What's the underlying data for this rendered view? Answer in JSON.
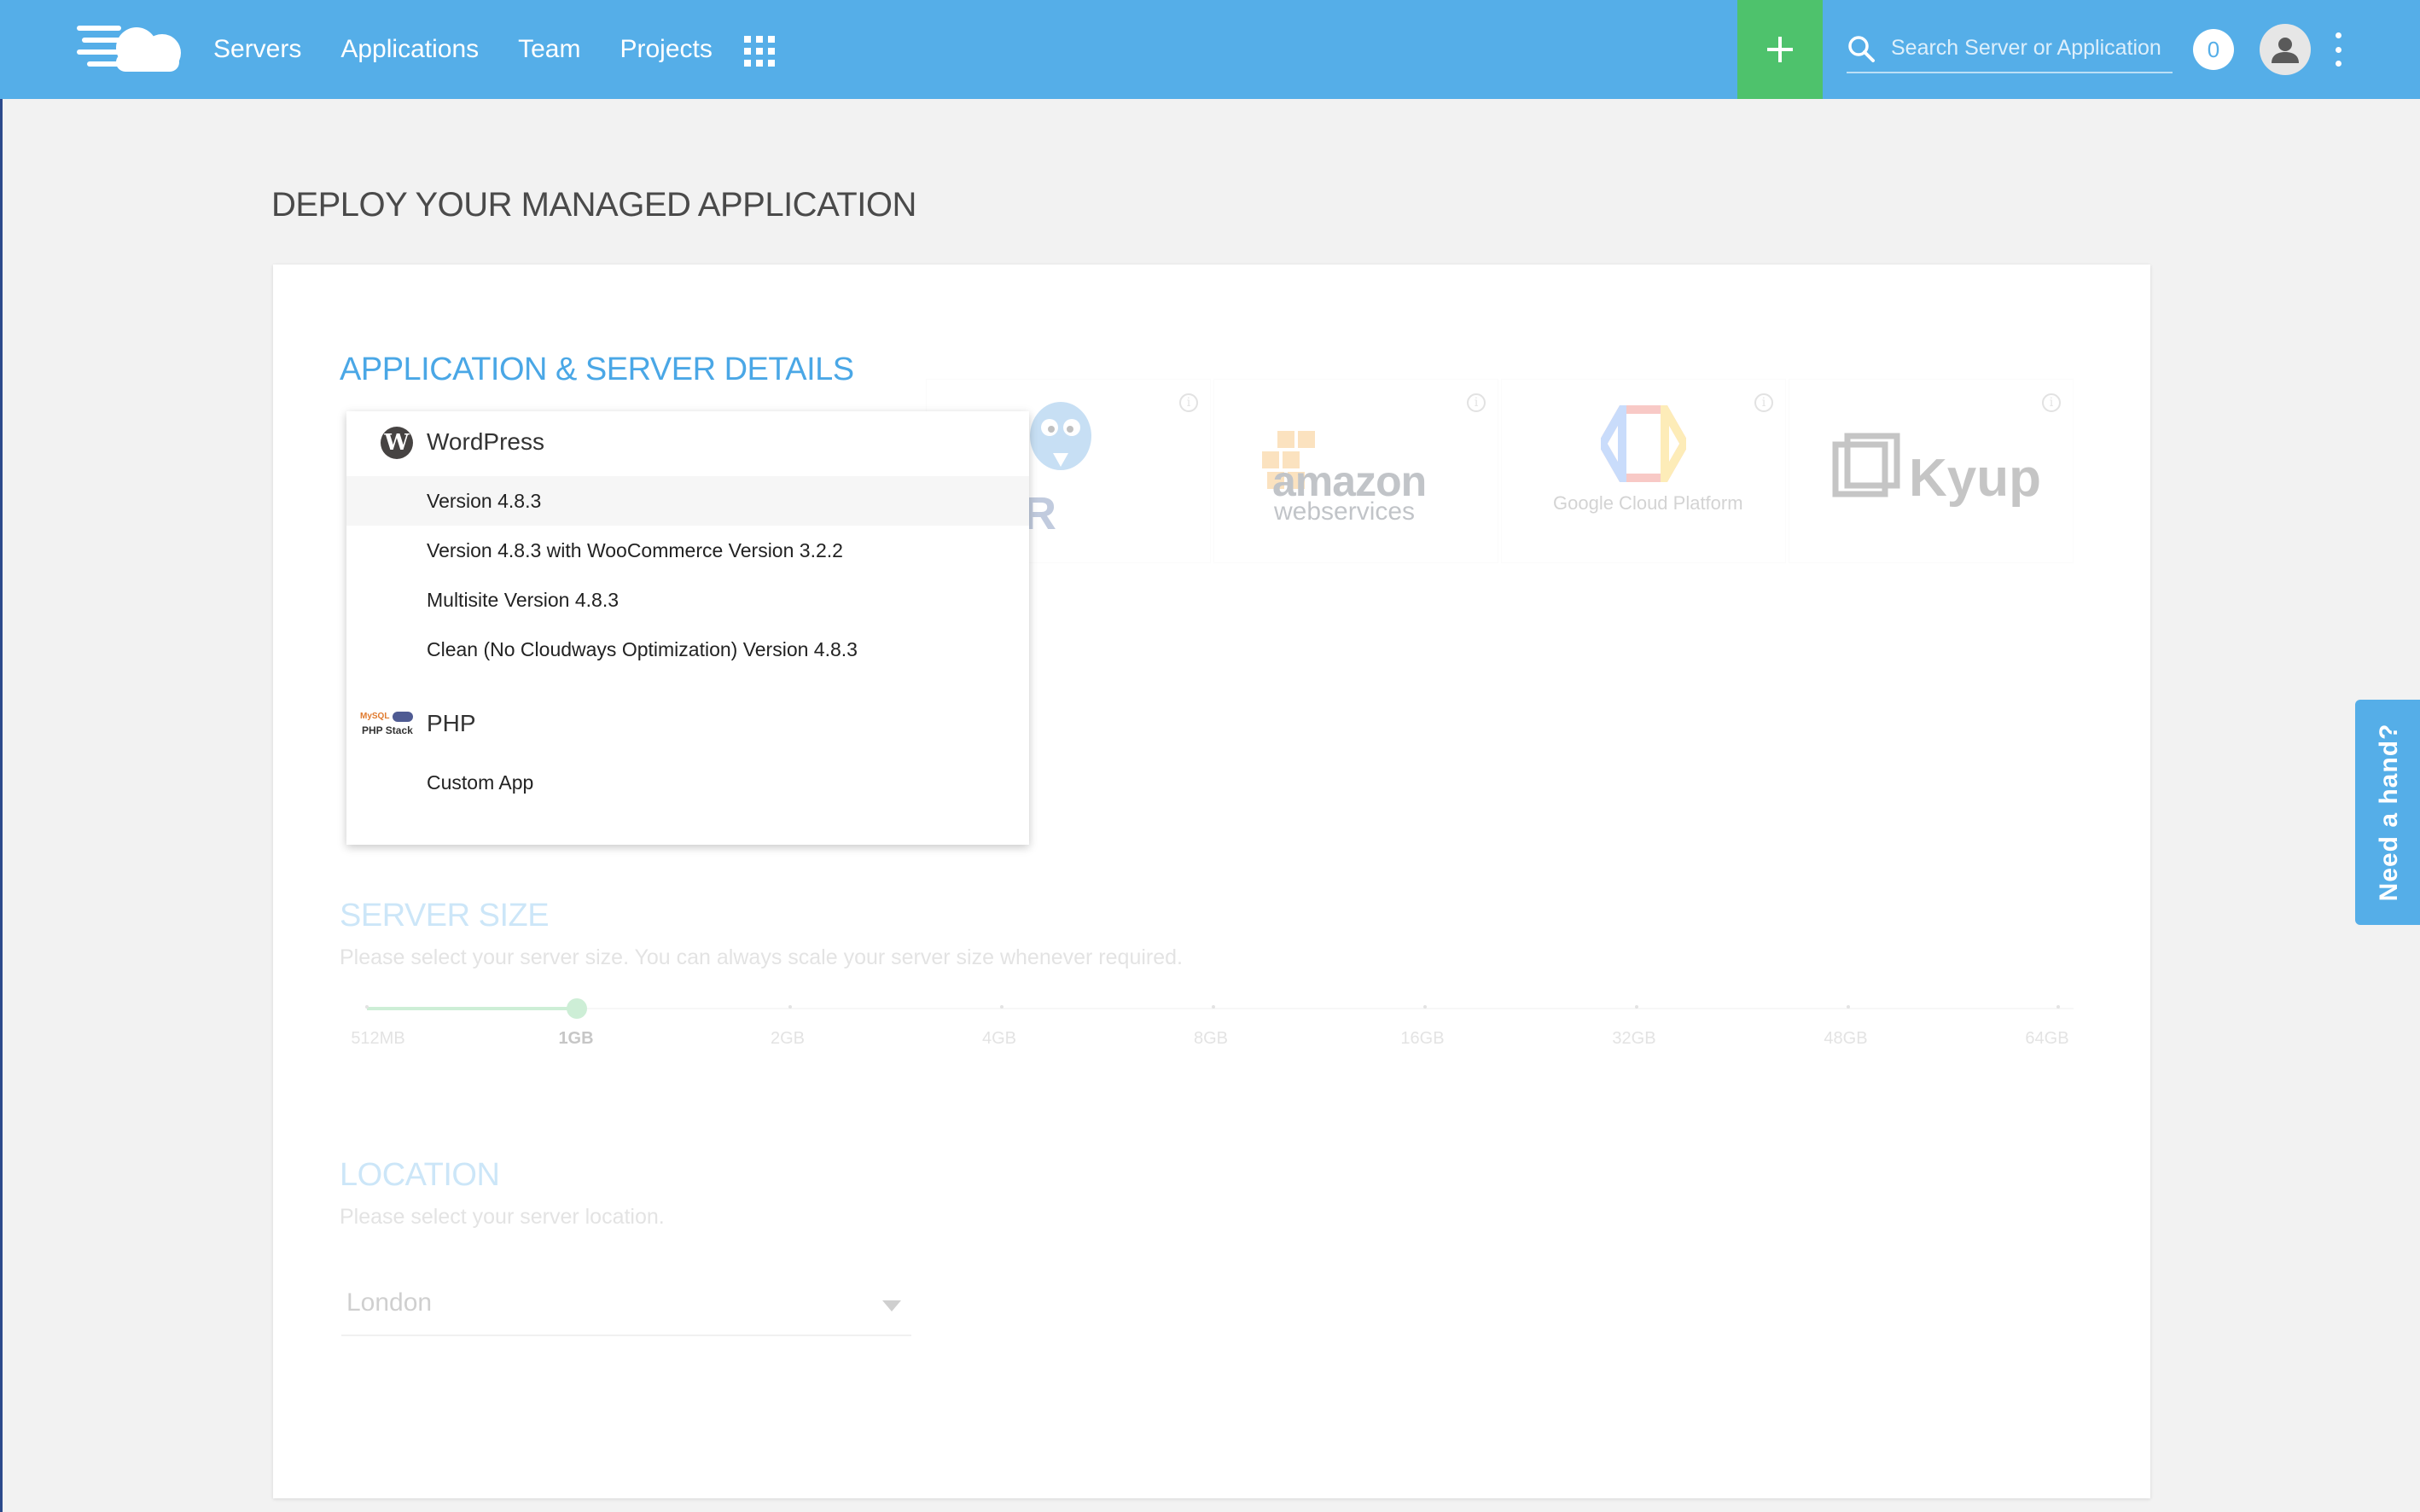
{
  "nav": {
    "items": [
      "Servers",
      "Applications",
      "Team",
      "Projects"
    ],
    "search_placeholder": "Search Server or Application",
    "notification_count": "0"
  },
  "page": {
    "title": "DEPLOY YOUR MANAGED APPLICATION"
  },
  "sections": {
    "app_server": {
      "heading": "APPLICATION & SERVER DETAILS"
    },
    "server_size": {
      "heading": "SERVER SIZE",
      "subtitle": "Please select your server size. You can always scale your server size whenever required.",
      "sizes": [
        "512MB",
        "1GB",
        "2GB",
        "4GB",
        "8GB",
        "16GB",
        "32GB",
        "48GB",
        "64GB"
      ],
      "selected": "1GB"
    },
    "location": {
      "heading": "LOCATION",
      "subtitle": "Please select your server location.",
      "value": "London"
    }
  },
  "providers": {
    "vultr": "ULTR",
    "amazon": "amazon",
    "amazon_sub": "webservices",
    "google": "Google Cloud Platform",
    "kyup": "Kyup"
  },
  "dropdown": {
    "wordpress": {
      "label": "WordPress",
      "options": [
        "Version 4.8.3",
        "Version 4.8.3 with WooCommerce Version 3.2.2",
        "Multisite Version 4.8.3",
        "Clean (No Cloudways Optimization) Version 4.8.3"
      ]
    },
    "php": {
      "label": "PHP",
      "icon_top": "MySQL",
      "icon_bottom": "PHP Stack",
      "options": [
        "Custom App"
      ]
    }
  },
  "help": {
    "label": "Need a hand?"
  },
  "colors": {
    "brand": "#55aee8",
    "accent_green": "#4ec26c",
    "heading_blue": "#4aa7e6"
  }
}
